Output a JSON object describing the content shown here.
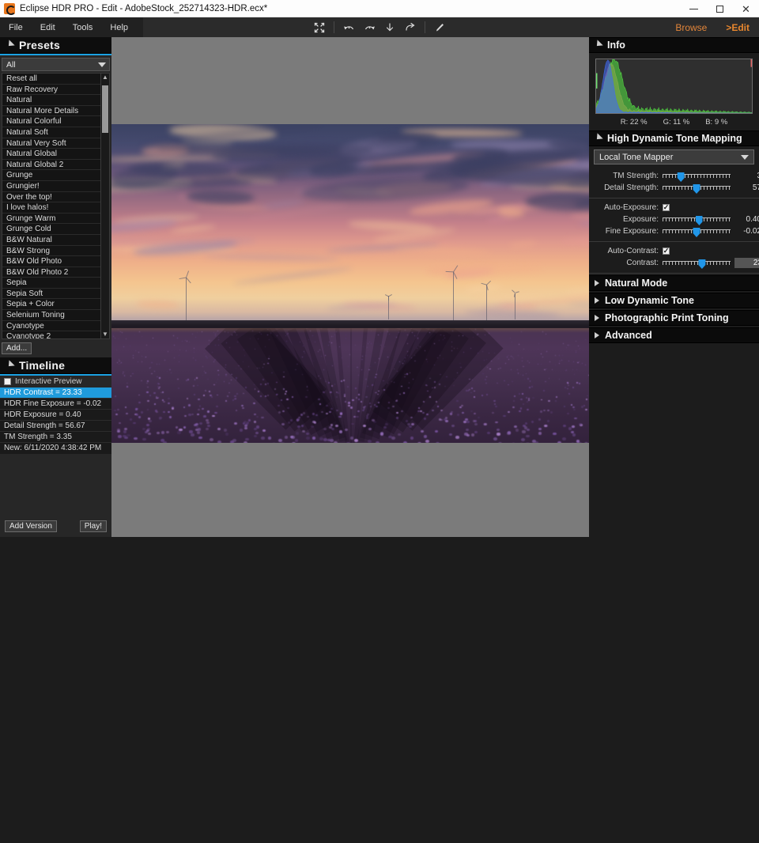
{
  "window": {
    "title": "Eclipse HDR PRO - Edit - AdobeStock_252714323-HDR.ecx*",
    "app_icon": "eclipse-logo-icon",
    "minimize_label": "",
    "maximize_label": "",
    "close_label": "✕"
  },
  "menu": {
    "items": [
      {
        "label": "File"
      },
      {
        "label": "Edit"
      },
      {
        "label": "Tools"
      },
      {
        "label": "Help"
      }
    ]
  },
  "toolbar": {
    "buttons": [
      {
        "name": "fit-to-screen-icon",
        "label": ""
      },
      {
        "name": "undo-icon",
        "label": ""
      },
      {
        "name": "redo-icon",
        "label": ""
      },
      {
        "name": "download-icon",
        "label": ""
      },
      {
        "name": "export-arrow-icon",
        "label": ""
      },
      {
        "name": "brush-icon",
        "label": ""
      }
    ]
  },
  "mode_switch": {
    "browse_label": "Browse",
    "edit_label": ">Edit",
    "accent_color": "#e2853a"
  },
  "presets": {
    "title": "Presets",
    "filter_value": "All",
    "items": [
      {
        "label": "Reset all"
      },
      {
        "label": "Raw Recovery"
      },
      {
        "label": "Natural"
      },
      {
        "label": "Natural More Details"
      },
      {
        "label": "Natural Colorful"
      },
      {
        "label": "Natural Soft"
      },
      {
        "label": "Natural Very Soft"
      },
      {
        "label": "Natural Global"
      },
      {
        "label": "Natural Global 2"
      },
      {
        "label": "Grunge"
      },
      {
        "label": "Grungier!"
      },
      {
        "label": "Over the top!"
      },
      {
        "label": "I love halos!"
      },
      {
        "label": "Grunge Warm"
      },
      {
        "label": "Grunge Cold"
      },
      {
        "label": "B&W Natural"
      },
      {
        "label": "B&W Strong"
      },
      {
        "label": "B&W Old Photo"
      },
      {
        "label": "B&W Old Photo 2"
      },
      {
        "label": "Sepia"
      },
      {
        "label": "Sepia Soft"
      },
      {
        "label": "Sepia + Color"
      },
      {
        "label": "Selenium Toning"
      },
      {
        "label": "Cyanotype"
      },
      {
        "label": "Cyanotype 2"
      }
    ],
    "add_button_label": "Add..."
  },
  "timeline": {
    "title": "Timeline",
    "interactive_preview_label": "Interactive Preview",
    "interactive_preview_checked": false,
    "items": [
      {
        "label": "HDR Contrast = 23.33",
        "selected": true
      },
      {
        "label": "HDR Fine Exposure = -0.02",
        "selected": false
      },
      {
        "label": "HDR Exposure = 0.40",
        "selected": false
      },
      {
        "label": "Detail Strength = 56.67",
        "selected": false
      },
      {
        "label": "TM Strength = 3.35",
        "selected": false
      },
      {
        "label": "New: 6/11/2020 4:38:42 PM",
        "selected": false
      }
    ],
    "add_version_label": "Add Version",
    "play_label": "Play!"
  },
  "info": {
    "title": "Info",
    "histogram": {
      "red_label": "R: 22 %",
      "green_label": "G: 11 %",
      "blue_label": "B: 9 %",
      "red_percent": 22,
      "green_percent": 11,
      "blue_percent": 9,
      "red_color": "#e06666",
      "green_color": "#52d642",
      "blue_color": "#4169f0"
    }
  },
  "tone_mapping": {
    "title": "High Dynamic Tone Mapping",
    "mapper_value": "Local Tone Mapper",
    "sliders": [
      {
        "label": "TM Strength:",
        "value": "3",
        "pos": 27
      },
      {
        "label": "Detail Strength:",
        "value": "57",
        "pos": 50
      }
    ],
    "auto_exposure_label": "Auto-Exposure:",
    "auto_exposure_checked": true,
    "exposure_sliders": [
      {
        "label": "Exposure:",
        "value": "0.40",
        "pos": 54
      },
      {
        "label": "Fine Exposure:",
        "value": "-0.02",
        "pos": 50
      }
    ],
    "auto_contrast_label": "Auto-Contrast:",
    "auto_contrast_checked": true,
    "contrast_slider": {
      "label": "Contrast:",
      "value": "23",
      "pos": 58
    }
  },
  "collapsed_sections": [
    {
      "label": "Natural Mode"
    },
    {
      "label": "Low Dynamic Tone"
    },
    {
      "label": "Photographic Print Toning"
    },
    {
      "label": "Advanced"
    }
  ],
  "image": {
    "description": "Lavender field at sunset with wind turbines on the horizon"
  }
}
